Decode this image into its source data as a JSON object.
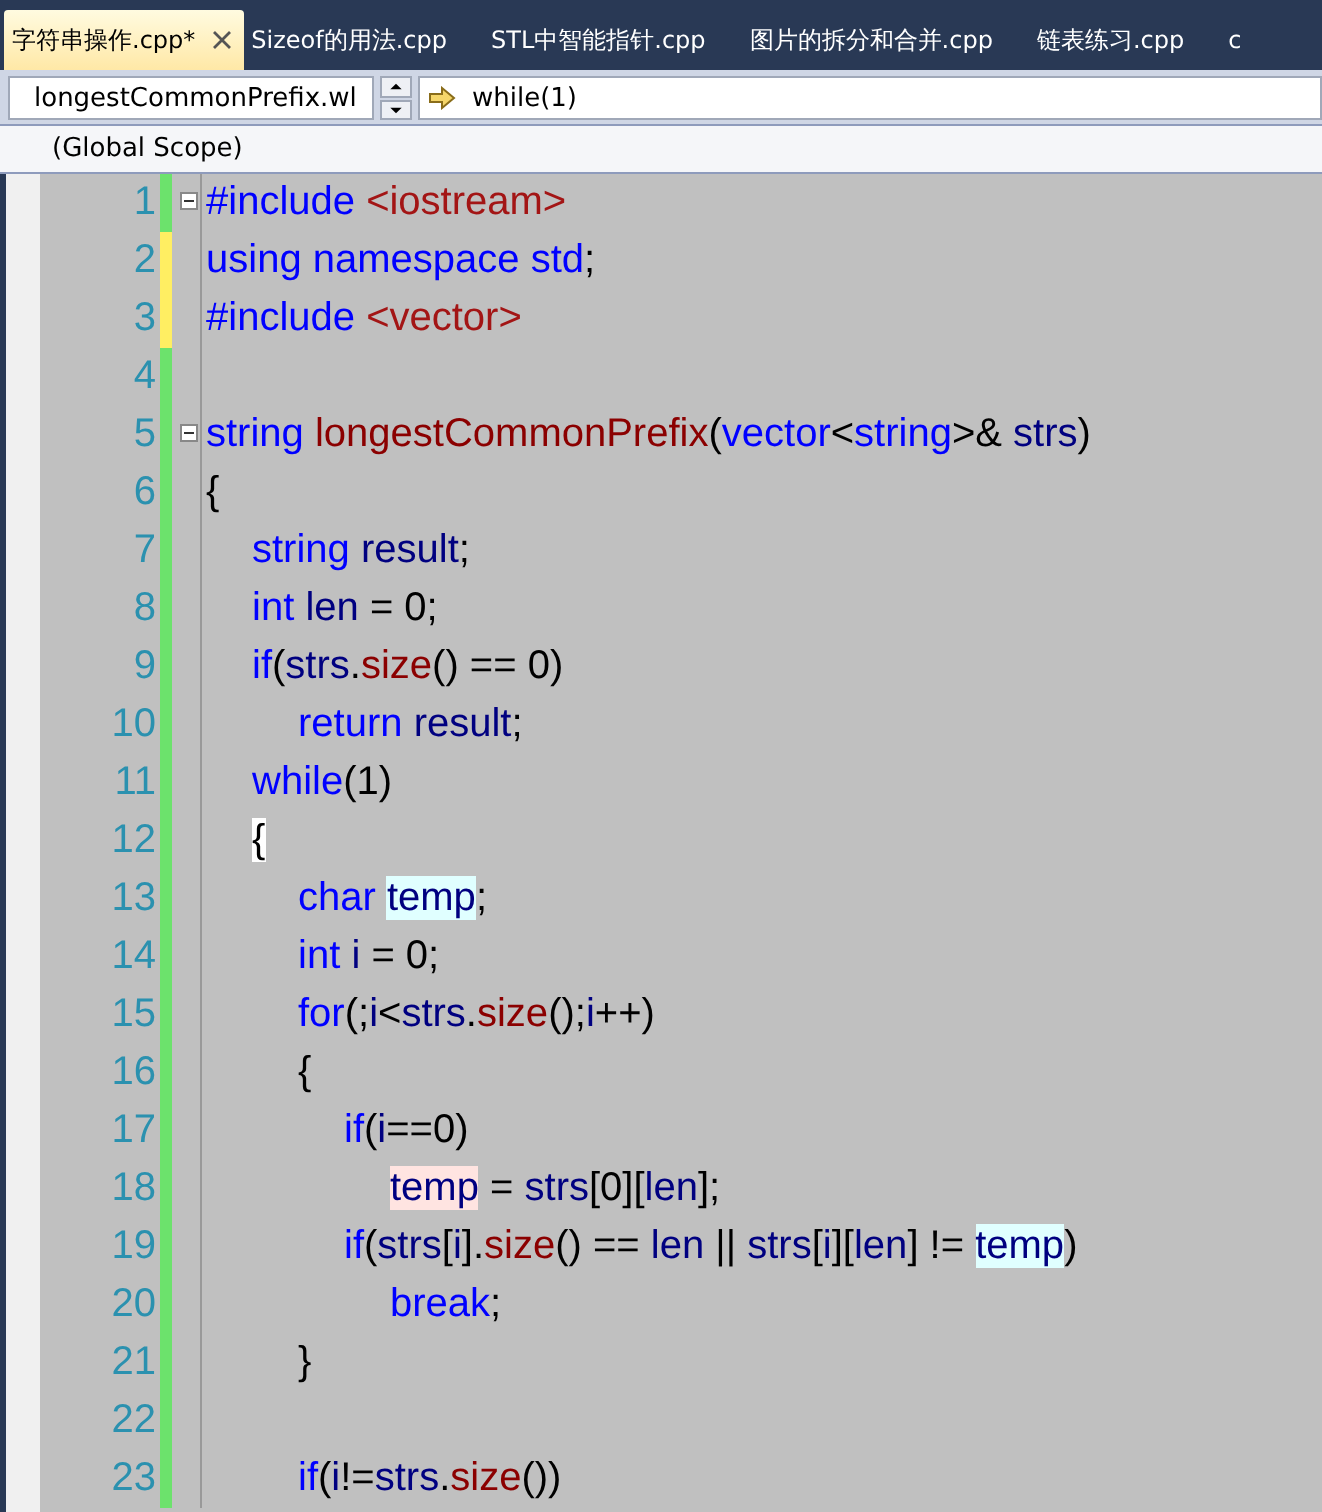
{
  "tabs": [
    {
      "label": "字符串操作.cpp*",
      "selected": true
    },
    {
      "label": "Sizeof的用法.cpp",
      "selected": false
    },
    {
      "label": "STL中智能指针.cpp",
      "selected": false
    },
    {
      "label": "图片的拆分和合并.cpp",
      "selected": false
    },
    {
      "label": "链表练习.cpp",
      "selected": false
    },
    {
      "label": "c",
      "selected": false
    }
  ],
  "navigation": {
    "member": "longestCommonPrefix.wl",
    "location": "while(1)",
    "scope": "(Global Scope)"
  },
  "editor": {
    "lines": [
      {
        "number": "1",
        "modified": false,
        "fold": true,
        "tokens": [
          {
            "kind": "kw",
            "text": "#include "
          },
          {
            "kind": "str",
            "text": "<iostream>"
          }
        ]
      },
      {
        "number": "2",
        "modified": true,
        "fold": false,
        "tokens": [
          {
            "kind": "kw",
            "text": "using namespace std"
          },
          {
            "kind": "pl",
            "text": ";"
          }
        ]
      },
      {
        "number": "3",
        "modified": true,
        "fold": false,
        "tokens": [
          {
            "kind": "kw",
            "text": "#include "
          },
          {
            "kind": "str",
            "text": "<vector>"
          }
        ]
      },
      {
        "number": "4",
        "modified": false,
        "fold": false
      },
      {
        "number": "5",
        "modified": false,
        "fold": true,
        "tokens": [
          {
            "kind": "kw",
            "text": "string "
          },
          {
            "kind": "fn",
            "text": "longestCommonPrefix"
          },
          {
            "kind": "pl",
            "text": "("
          },
          {
            "kind": "kw",
            "text": "vector"
          },
          {
            "kind": "pl",
            "text": "<"
          },
          {
            "kind": "kw",
            "text": "string"
          },
          {
            "kind": "pl",
            "text": ">& "
          },
          {
            "kind": "id",
            "text": "strs"
          },
          {
            "kind": "pl",
            "text": ")"
          }
        ]
      },
      {
        "number": "6",
        "modified": false,
        "fold": false,
        "tokens": [
          {
            "kind": "pl",
            "text": "{"
          }
        ],
        "children": [
          {
            "number": "7",
            "modified": false,
            "fold": false,
            "tokens": [
              {
                "kind": "kw",
                "text": "string "
              },
              {
                "kind": "id",
                "text": "result"
              },
              {
                "kind": "pl",
                "text": ";"
              }
            ]
          },
          {
            "number": "8",
            "modified": false,
            "fold": false,
            "tokens": [
              {
                "kind": "kw",
                "text": "int "
              },
              {
                "kind": "id",
                "text": "len"
              },
              {
                "kind": "pl",
                "text": " = 0;"
              }
            ]
          },
          {
            "number": "9",
            "modified": false,
            "fold": false,
            "tokens": [
              {
                "kind": "kw",
                "text": "if"
              },
              {
                "kind": "pl",
                "text": "("
              },
              {
                "kind": "id",
                "text": "strs"
              },
              {
                "kind": "pl",
                "text": "."
              },
              {
                "kind": "fn",
                "text": "size"
              },
              {
                "kind": "pl",
                "text": "() == 0)"
              }
            ],
            "children": [
              {
                "number": "10",
                "modified": false,
                "fold": false,
                "tokens": [
                  {
                    "kind": "kw",
                    "text": "return "
                  },
                  {
                    "kind": "id",
                    "text": "result"
                  },
                  {
                    "kind": "pl",
                    "text": ";"
                  }
                ]
              }
            ]
          },
          {
            "number": "11",
            "modified": false,
            "fold": false,
            "tokens": [
              {
                "kind": "kw",
                "text": "while"
              },
              {
                "kind": "pl",
                "text": "(1)"
              }
            ]
          },
          {
            "number": "12",
            "modified": false,
            "fold": false,
            "tokens": [
              {
                "kind": "brace",
                "text": "{"
              }
            ],
            "children": [
              {
                "number": "13",
                "modified": false,
                "fold": false,
                "tokens": [
                  {
                    "kind": "kw",
                    "text": "char "
                  },
                  {
                    "kind": "read_ref",
                    "text": "temp"
                  },
                  {
                    "kind": "pl",
                    "text": ";"
                  }
                ]
              },
              {
                "number": "14",
                "modified": false,
                "fold": false,
                "tokens": [
                  {
                    "kind": "kw",
                    "text": "int "
                  },
                  {
                    "kind": "id",
                    "text": "i"
                  },
                  {
                    "kind": "pl",
                    "text": " = 0;"
                  }
                ]
              },
              {
                "number": "15",
                "modified": false,
                "fold": false,
                "tokens": [
                  {
                    "kind": "kw",
                    "text": "for"
                  },
                  {
                    "kind": "pl",
                    "text": "(;"
                  },
                  {
                    "kind": "id",
                    "text": "i"
                  },
                  {
                    "kind": "pl",
                    "text": "<"
                  },
                  {
                    "kind": "id",
                    "text": "strs"
                  },
                  {
                    "kind": "pl",
                    "text": "."
                  },
                  {
                    "kind": "fn",
                    "text": "size"
                  },
                  {
                    "kind": "pl",
                    "text": "();"
                  },
                  {
                    "kind": "id",
                    "text": "i"
                  },
                  {
                    "kind": "pl",
                    "text": "++)"
                  }
                ]
              },
              {
                "number": "16",
                "modified": false,
                "fold": false,
                "tokens": [
                  {
                    "kind": "pl",
                    "text": "{"
                  }
                ],
                "children": [
                  {
                    "number": "17",
                    "modified": false,
                    "fold": false,
                    "tokens": [
                      {
                        "kind": "kw",
                        "text": "if"
                      },
                      {
                        "kind": "pl",
                        "text": "("
                      },
                      {
                        "kind": "id",
                        "text": "i"
                      },
                      {
                        "kind": "pl",
                        "text": "==0)"
                      }
                    ],
                    "children": [
                      {
                        "number": "18",
                        "modified": false,
                        "fold": false,
                        "tokens": [
                          {
                            "kind": "write_ref",
                            "text": "temp"
                          },
                          {
                            "kind": "pl",
                            "text": " = "
                          },
                          {
                            "kind": "id",
                            "text": "strs"
                          },
                          {
                            "kind": "pl",
                            "text": "[0]["
                          },
                          {
                            "kind": "id",
                            "text": "len"
                          },
                          {
                            "kind": "pl",
                            "text": "];"
                          }
                        ]
                      }
                    ]
                  },
                  {
                    "number": "19",
                    "modified": false,
                    "fold": false,
                    "tokens": [
                      {
                        "kind": "kw",
                        "text": "if"
                      },
                      {
                        "kind": "pl",
                        "text": "("
                      },
                      {
                        "kind": "id",
                        "text": "strs"
                      },
                      {
                        "kind": "pl",
                        "text": "["
                      },
                      {
                        "kind": "id",
                        "text": "i"
                      },
                      {
                        "kind": "pl",
                        "text": "]."
                      },
                      {
                        "kind": "fn",
                        "text": "size"
                      },
                      {
                        "kind": "pl",
                        "text": "() == "
                      },
                      {
                        "kind": "id",
                        "text": "len"
                      },
                      {
                        "kind": "pl",
                        "text": " || "
                      },
                      {
                        "kind": "id",
                        "text": "strs"
                      },
                      {
                        "kind": "pl",
                        "text": "["
                      },
                      {
                        "kind": "id",
                        "text": "i"
                      },
                      {
                        "kind": "pl",
                        "text": "]["
                      },
                      {
                        "kind": "id",
                        "text": "len"
                      },
                      {
                        "kind": "pl",
                        "text": "] != "
                      },
                      {
                        "kind": "read_ref",
                        "text": "temp"
                      },
                      {
                        "kind": "pl",
                        "text": ")"
                      }
                    ],
                    "children": [
                      {
                        "number": "20",
                        "modified": false,
                        "fold": false,
                        "tokens": [
                          {
                            "kind": "kw",
                            "text": "break"
                          },
                          {
                            "kind": "pl",
                            "text": ";"
                          }
                        ]
                      }
                    ]
                  }
                ]
              },
              {
                "number": "21",
                "modified": false,
                "fold": false,
                "tokens": [
                  {
                    "kind": "pl",
                    "text": "}"
                  }
                ]
              },
              {
                "number": "22",
                "modified": false,
                "fold": false
              },
              {
                "number": "23",
                "modified": false,
                "fold": false,
                "tokens": [
                  {
                    "kind": "kw",
                    "text": "if"
                  },
                  {
                    "kind": "pl",
                    "text": "("
                  },
                  {
                    "kind": "id",
                    "text": "i"
                  },
                  {
                    "kind": "pl",
                    "text": "!="
                  },
                  {
                    "kind": "id",
                    "text": "strs"
                  },
                  {
                    "kind": "pl",
                    "text": "."
                  },
                  {
                    "kind": "fn",
                    "text": "size"
                  },
                  {
                    "kind": "pl",
                    "text": "())"
                  }
                ]
              }
            ]
          }
        ]
      }
    ]
  }
}
